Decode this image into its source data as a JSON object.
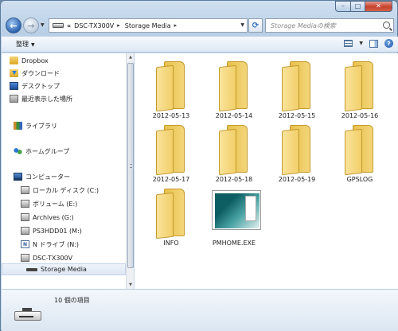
{
  "window": {
    "caption_buttons": {
      "minimize": "–",
      "maximize": "□",
      "close": "✕"
    }
  },
  "navigation": {
    "back_glyph": "←",
    "forward_glyph": "→",
    "address": {
      "prefix": "«",
      "segments": [
        "DSC-TX300V",
        "Storage Media"
      ],
      "separator": "▸"
    },
    "search_placeholder": "Storage Mediaの検索",
    "refresh_glyph": "⟳"
  },
  "toolbar": {
    "organize_label": "整理"
  },
  "nav_pane": {
    "favorites": [
      "Dropbox",
      "ダウンロード",
      "デスクトップ",
      "最近表示した場所"
    ],
    "libraries": "ライブラリ",
    "homegroup": "ホームグループ",
    "computer": "コンピューター",
    "drives": [
      "ローカル ディスク (C:)",
      "ボリューム (E:)",
      "Archives (G:)",
      "PS3HDD01 (M:)",
      "N ドライブ (N:)",
      "DSC-TX300V",
      "Storage Media"
    ],
    "ndrive_badge": "N"
  },
  "content": {
    "items": [
      "2012-05-13",
      "2012-05-14",
      "2012-05-15",
      "2012-05-16",
      "2012-05-17",
      "2012-05-18",
      "2012-05-19",
      "GPSLOG",
      "INFO",
      "PMHOME.EXE"
    ]
  },
  "details": {
    "item_count": "10 個の項目"
  },
  "colors": {
    "folder": "#f2cf69",
    "selection": "#dde7f3",
    "accent": "#2d64b0"
  }
}
